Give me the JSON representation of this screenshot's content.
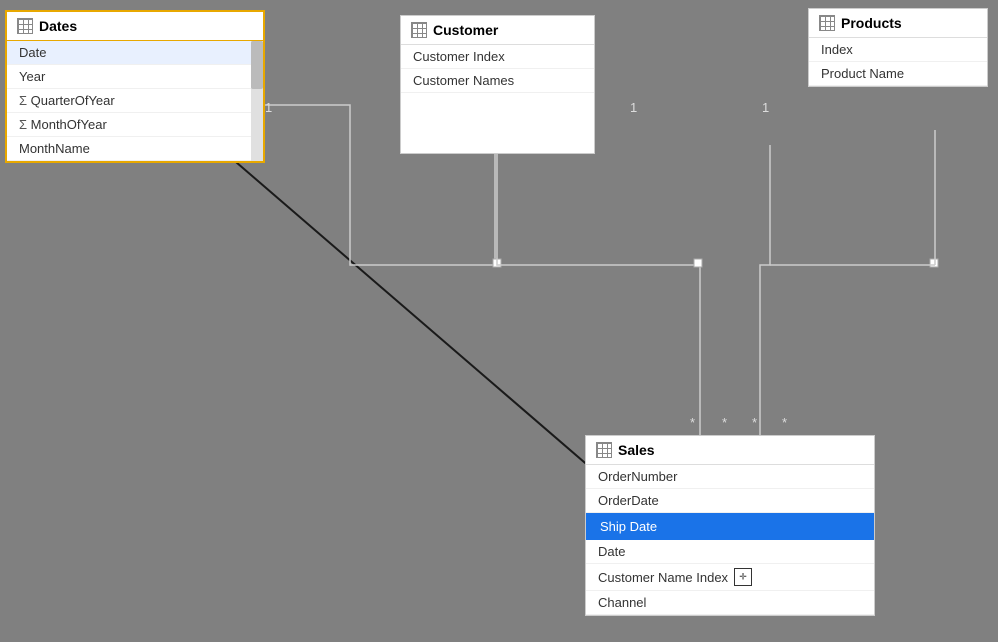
{
  "dates": {
    "title": "Dates",
    "fields": [
      {
        "name": "Date",
        "type": "normal",
        "selected": false,
        "header_row": true
      },
      {
        "name": "Year",
        "type": "normal",
        "selected": false
      },
      {
        "name": "QuarterOfYear",
        "type": "sigma"
      },
      {
        "name": "MonthOfYear",
        "type": "sigma"
      },
      {
        "name": "MonthName",
        "type": "normal"
      }
    ]
  },
  "customer": {
    "title": "Customer",
    "fields": [
      {
        "name": "Customer Index"
      },
      {
        "name": "Customer Names"
      }
    ]
  },
  "products": {
    "title": "Products",
    "fields": [
      {
        "name": "Index"
      },
      {
        "name": "Product Name"
      }
    ]
  },
  "sales": {
    "title": "Sales",
    "fields": [
      {
        "name": "OrderNumber"
      },
      {
        "name": "OrderDate"
      },
      {
        "name": "Ship Date",
        "selected": true
      },
      {
        "name": "Date"
      },
      {
        "name": "Customer Name Index"
      },
      {
        "name": "Channel"
      }
    ]
  },
  "relation_labels": {
    "one_dates": "1",
    "one_customer_left": "1",
    "one_customer_right": "1",
    "star1": "*",
    "star2": "*",
    "star3": "*",
    "star4": "*"
  },
  "partial_text": "Cus"
}
